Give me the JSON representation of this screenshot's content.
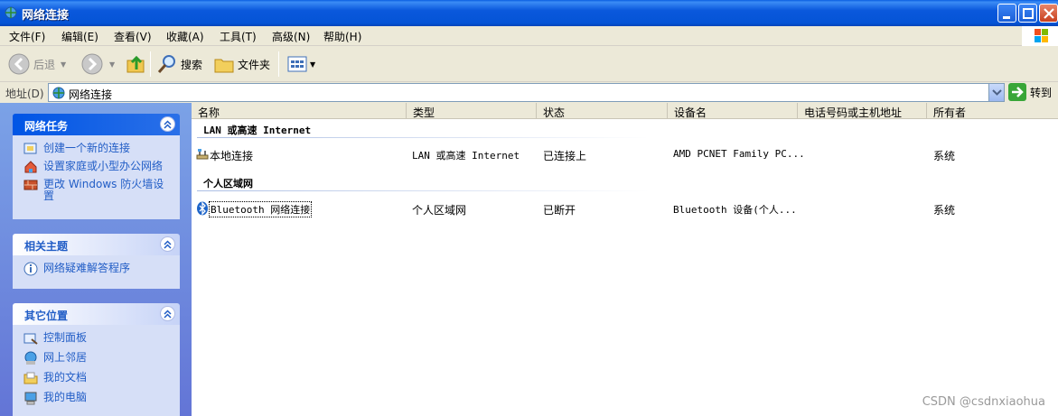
{
  "window": {
    "title": "网络连接"
  },
  "menu": [
    "文件(F)",
    "编辑(E)",
    "查看(V)",
    "收藏(A)",
    "工具(T)",
    "高级(N)",
    "帮助(H)"
  ],
  "toolbar": {
    "back": "后退",
    "search": "搜索",
    "folders": "文件夹"
  },
  "address": {
    "label": "地址(D)",
    "value": "网络连接",
    "go": "转到"
  },
  "panels": {
    "network_tasks": {
      "title": "网络任务",
      "items": [
        "创建一个新的连接",
        "设置家庭或小型办公网络",
        "更改 Windows 防火墙设置"
      ]
    },
    "related": {
      "title": "相关主题",
      "items": [
        "网络疑难解答程序"
      ]
    },
    "other": {
      "title": "其它位置",
      "items": [
        "控制面板",
        "网上邻居",
        "我的文档",
        "我的电脑"
      ]
    }
  },
  "columns": [
    "名称",
    "类型",
    "状态",
    "设备名",
    "电话号码或主机地址",
    "所有者"
  ],
  "groups": [
    {
      "title": "LAN 或高速 Internet",
      "rows": [
        {
          "name": "本地连接",
          "type": "LAN 或高速 Internet",
          "status": "已连接上",
          "device": "AMD PCNET Family PC...",
          "phone": "",
          "owner": "系统"
        }
      ]
    },
    {
      "title": "个人区域网",
      "rows": [
        {
          "name": "Bluetooth 网络连接",
          "type": "个人区域网",
          "status": "已断开",
          "device": "Bluetooth 设备(个人...",
          "phone": "",
          "owner": "系统"
        }
      ]
    }
  ],
  "watermark": "CSDN @csdnxiaohua",
  "colors": {
    "title_bar": "#0554d6",
    "task_pane": "#6375d6",
    "link": "#215dc6"
  }
}
